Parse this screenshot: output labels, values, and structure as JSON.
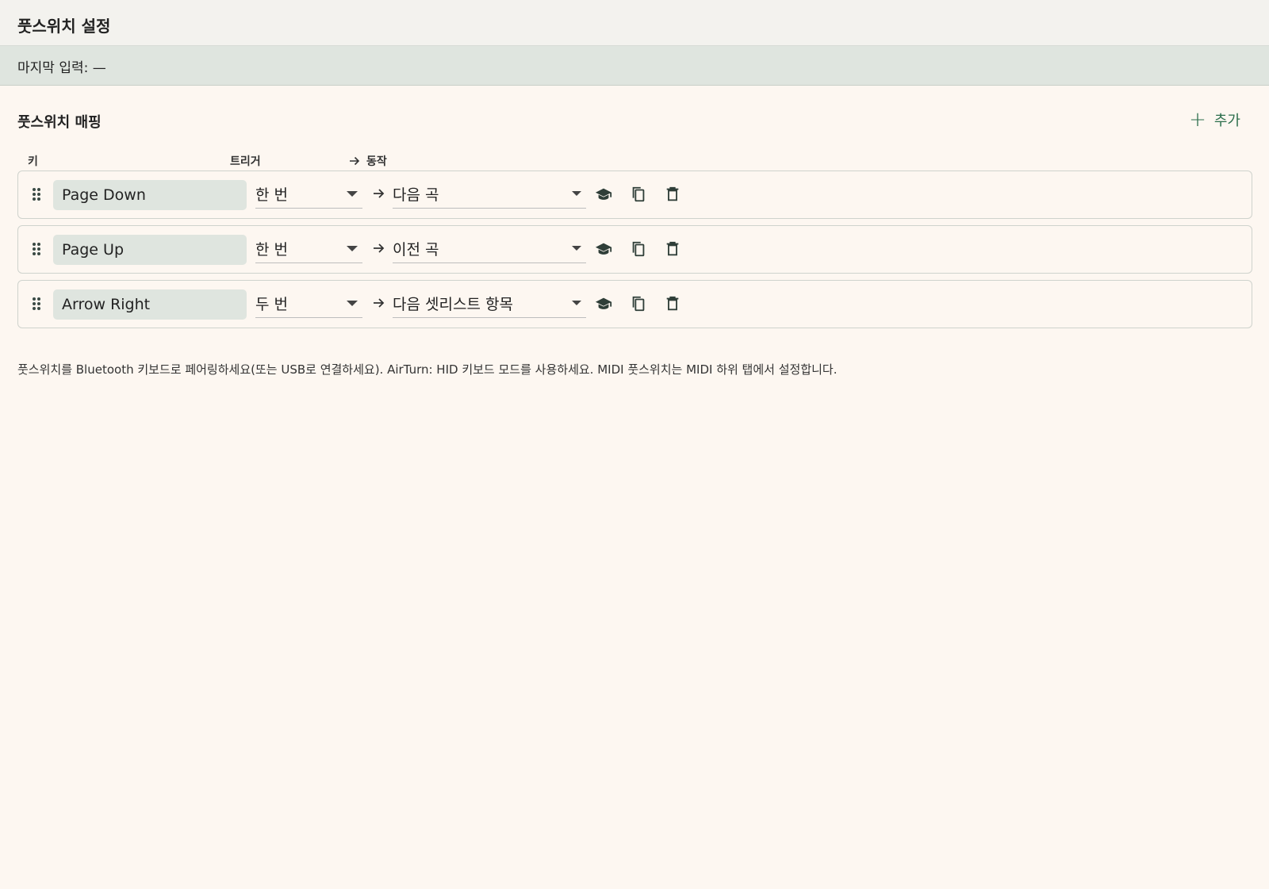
{
  "header": {
    "title": "풋스위치 설정"
  },
  "status": {
    "last_input": "마지막 입력: —"
  },
  "mappings_section": {
    "title": "풋스위치 매핑",
    "add_label": "추가",
    "columns": {
      "key": "키",
      "trigger": "트리거",
      "action": "동작"
    },
    "rows": [
      {
        "key": "Page Down",
        "trigger": "한 번",
        "action": "다음 곡"
      },
      {
        "key": "Page Up",
        "trigger": "한 번",
        "action": "이전 곡"
      },
      {
        "key": "Arrow Right",
        "trigger": "두 번",
        "action": "다음 셋리스트 항목"
      }
    ]
  },
  "footnote": "풋스위치를 Bluetooth 키보드로 페어링하세요(또는 USB로 연결하세요). AirTurn: HID 키보드 모드를 사용하세요. MIDI 풋스위치는 MIDI 하위 탭에서 설정합니다.",
  "icons": {
    "drag": "drag-handle-icon",
    "learn": "graduation-cap-icon",
    "copy": "copy-icon",
    "delete": "trash-icon",
    "add": "plus-icon",
    "arrow": "arrow-right-icon"
  },
  "colors": {
    "accent": "#2c6e4c",
    "background": "#fdf7f1",
    "status_bar": "#dfe5df"
  }
}
